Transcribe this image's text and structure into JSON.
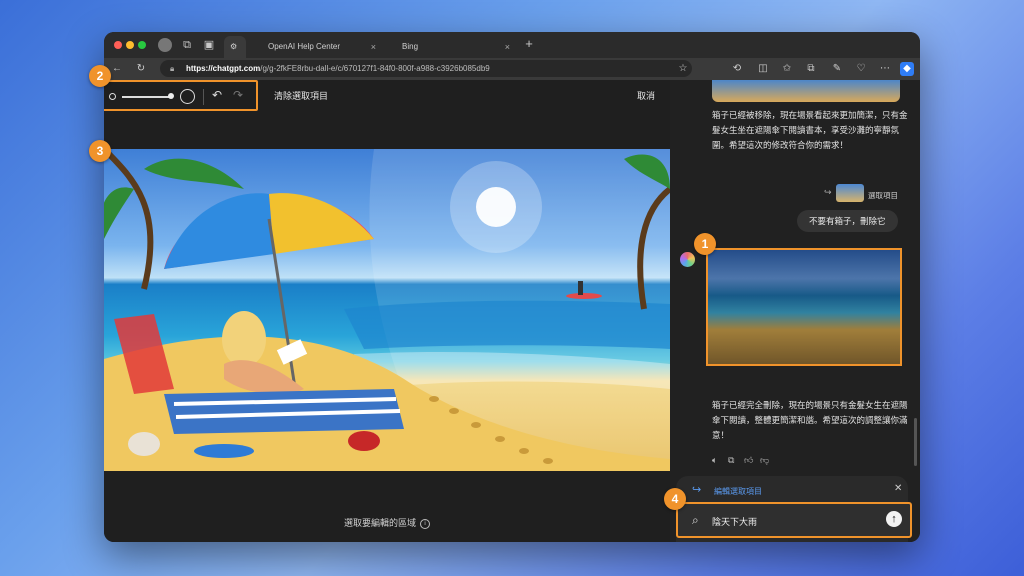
{
  "browser": {
    "tabs": [
      {
        "label": ""
      },
      {
        "label": "OpenAI Help Center"
      },
      {
        "label": "Bing"
      }
    ],
    "address": {
      "domain": "https://chatgpt.com",
      "path": "/g/g-2fkFE8rbu-dall-e/c/670127f1-84f0-800f-a988-c3926b085db9"
    }
  },
  "editor": {
    "clear_selection": "清除選取項目",
    "cancel": "取消",
    "hint": "選取要編輯的區域"
  },
  "chat": {
    "msg1": "箱子已經被移除，現在場景看起來更加簡潔，只有金髮女生坐在遮陽傘下閱讀書本，享受沙灘的寧靜氛圍。希望這次的修改符合你的需求！",
    "selected_label": "選取項目",
    "user_msg": "不要有箱子，刪除它",
    "msg2": "箱子已經完全刪除，現在的場景只有金髮女生在遮陽傘下閱讀，整體更簡潔和諧。希望這次的調整讓你滿意！",
    "edit_selection": "編輯選取項目",
    "input_value": "陰天下大雨"
  },
  "badges": [
    "1",
    "2",
    "3",
    "4"
  ],
  "colors": {
    "accent": "#f0932b",
    "link": "#5b9bf0"
  }
}
